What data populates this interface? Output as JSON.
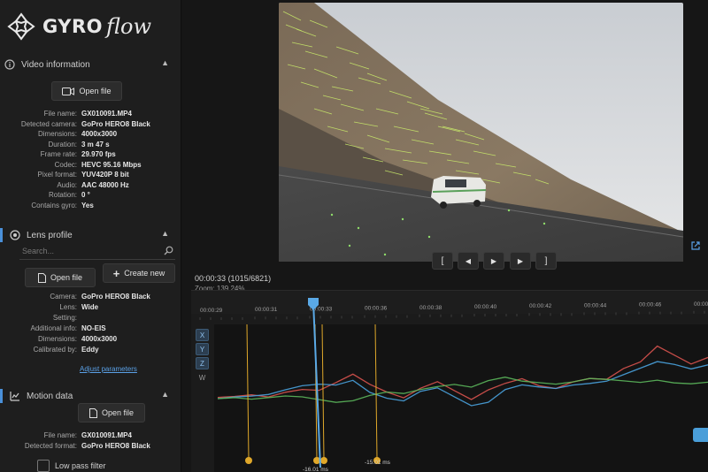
{
  "app": {
    "logo_word1": "GYRO",
    "logo_word2": "flow"
  },
  "video_info": {
    "title": "Video information",
    "open_button": "Open file",
    "fields": [
      {
        "label": "File name:",
        "value": "GX010091.MP4"
      },
      {
        "label": "Detected camera:",
        "value": "GoPro HERO8 Black"
      },
      {
        "label": "Dimensions:",
        "value": "4000x3000"
      },
      {
        "label": "Duration:",
        "value": "3 m 47 s"
      },
      {
        "label": "Frame rate:",
        "value": "29.970 fps"
      },
      {
        "label": "Codec:",
        "value": "HEVC 95.16 Mbps"
      },
      {
        "label": "Pixel format:",
        "value": "YUV420P 8 bit"
      },
      {
        "label": "Audio:",
        "value": "AAC 48000 Hz"
      },
      {
        "label": "Rotation:",
        "value": "0 °"
      },
      {
        "label": "Contains gyro:",
        "value": "Yes"
      }
    ]
  },
  "lens_profile": {
    "title": "Lens profile",
    "search_placeholder": "Search...",
    "open_button": "Open file",
    "create_button": "Create new",
    "fields": [
      {
        "label": "Camera:",
        "value": "GoPro HERO8 Black"
      },
      {
        "label": "Lens:",
        "value": "Wide"
      },
      {
        "label": "Setting:",
        "value": ""
      },
      {
        "label": "Additional info:",
        "value": "NO-EIS"
      },
      {
        "label": "Dimensions:",
        "value": "4000x3000"
      },
      {
        "label": "Calibrated by:",
        "value": "Eddy"
      }
    ],
    "adjust_link": "Adjust parameters"
  },
  "motion_data": {
    "title": "Motion data",
    "open_button": "Open file",
    "fields": [
      {
        "label": "File name:",
        "value": "GX010091.MP4"
      },
      {
        "label": "Detected format:",
        "value": "GoPro HERO8 Black"
      }
    ],
    "lowpass_label": "Low pass filter"
  },
  "playback": {
    "buttons": [
      "[",
      "◀",
      "▶",
      "▶",
      "]"
    ]
  },
  "timeline": {
    "current_time": "00:00:33",
    "frame_info": "(1015/6821)",
    "zoom": "Zoom: 139.24%",
    "ticks": [
      "00:00:29",
      "00:00:31",
      "00:00:33",
      "00:00:36",
      "00:00:38",
      "00:00:40",
      "00:00:42",
      "00:00:44",
      "00:00:46",
      "00:00:48"
    ],
    "axis_buttons": [
      "X",
      "Y",
      "Z",
      "W"
    ],
    "marker_labels": [
      "-16.01 ms",
      "-15.01 ms"
    ],
    "colors": {
      "x": "#d9534f",
      "y": "#4aa3df",
      "z": "#5cb85c",
      "marker": "#e0a82a",
      "playhead": "#5aa9e6"
    },
    "gyro_series": [
      {
        "name": "x",
        "values": [
          0.02,
          0.03,
          0.05,
          0.01,
          0.08,
          0.12,
          0.1,
          0.22,
          0.35,
          0.18,
          0.05,
          -0.05,
          0.1,
          0.2,
          0.05,
          -0.1,
          0.05,
          0.15,
          0.22,
          0.1,
          0.05,
          0.15,
          0.2,
          0.18,
          0.35,
          0.45,
          0.7,
          0.55,
          0.4,
          0.5
        ]
      },
      {
        "name": "y",
        "values": [
          0.0,
          0.02,
          0.03,
          0.05,
          0.12,
          0.18,
          0.2,
          0.18,
          0.25,
          0.05,
          -0.05,
          -0.1,
          0.05,
          0.1,
          -0.05,
          -0.2,
          -0.15,
          0.05,
          0.12,
          0.08,
          0.05,
          0.1,
          0.12,
          0.15,
          0.25,
          0.35,
          0.45,
          0.4,
          0.32,
          0.38
        ]
      },
      {
        "name": "z",
        "values": [
          0.0,
          0.01,
          -0.02,
          0.0,
          0.02,
          0.0,
          -0.05,
          -0.1,
          -0.08,
          0.0,
          0.05,
          0.02,
          0.08,
          0.12,
          0.15,
          0.1,
          0.2,
          0.25,
          0.18,
          0.15,
          0.12,
          0.15,
          0.2,
          0.18,
          0.15,
          0.12,
          0.15,
          0.1,
          0.08,
          0.1
        ]
      }
    ]
  }
}
